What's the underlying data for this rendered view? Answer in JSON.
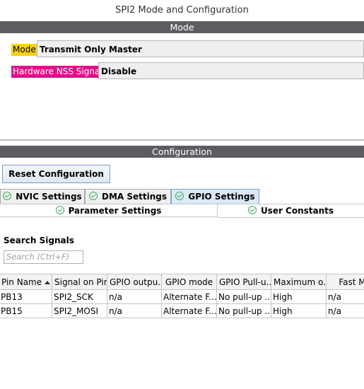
{
  "title": "SPI2 Mode and Configuration",
  "mode_section": {
    "header": "Mode",
    "rows": [
      {
        "label": "Mode",
        "value": "Transmit Only Master"
      },
      {
        "label": "Hardware NSS Signal",
        "value": "Disable"
      }
    ]
  },
  "config_section": {
    "header": "Configuration",
    "reset_button": "Reset Configuration",
    "tabs": [
      "NVIC Settings",
      "DMA Settings",
      "GPIO Settings"
    ],
    "active_tab": "GPIO Settings",
    "subtabs": [
      "Parameter Settings",
      "User Constants"
    ]
  },
  "search": {
    "label": "Search Signals",
    "placeholder": "Search (Ctrl+F)"
  },
  "table": {
    "columns": [
      "Pin Name",
      "Signal on Pin",
      "GPIO outpu...",
      "GPIO mode",
      "GPIO Pull-u...",
      "Maximum o...",
      "Fast Mo"
    ],
    "rows": [
      [
        "PB13",
        "SPI2_SCK",
        "n/a",
        "Alternate F...",
        "No pull-up ...",
        "High",
        "n/a"
      ],
      [
        "PB15",
        "SPI2_MOSI",
        "n/a",
        "Alternate F...",
        "No pull-up ...",
        "High",
        "n/a"
      ]
    ]
  },
  "colors": {
    "mode_label_highlight": "#f7d117",
    "nss_label_highlight": "#e0108a",
    "section_bar": "#5b5d62",
    "check_icon": "#3cae5a"
  }
}
